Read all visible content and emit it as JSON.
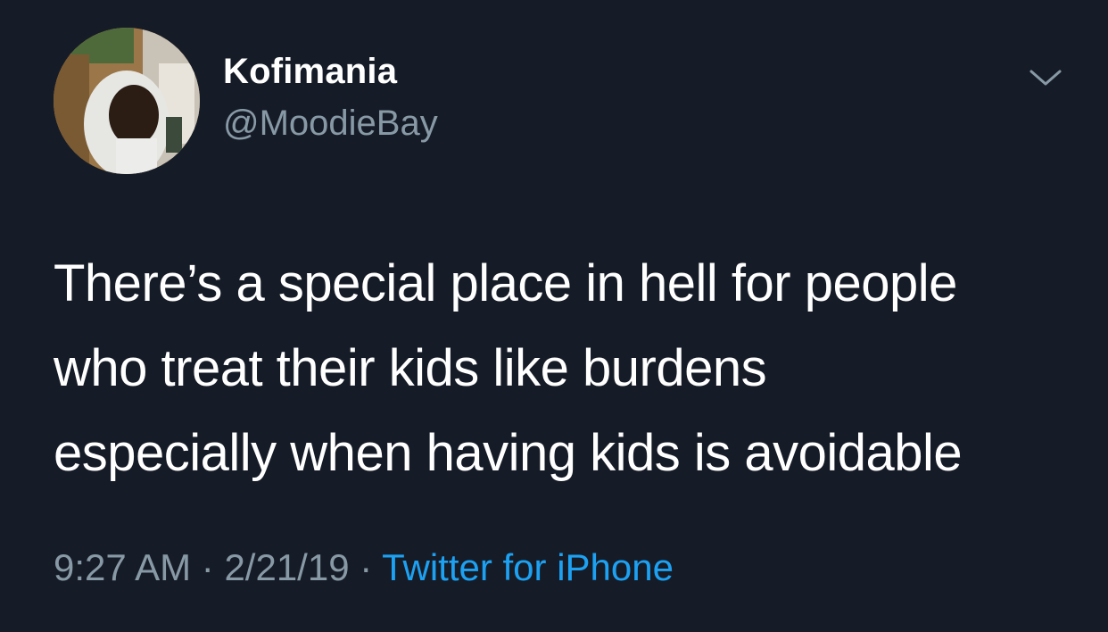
{
  "user": {
    "display_name": "Kofimania",
    "handle": "@MoodieBay"
  },
  "tweet": {
    "lines": [
      "There’s a special place in hell for people",
      "who treat their kids like burdens",
      "especially when having kids is avoidable"
    ]
  },
  "meta": {
    "time": "9:27 AM",
    "sep1": " · ",
    "date": "2/21/19",
    "sep2": " · ",
    "source": "Twitter for iPhone"
  },
  "icons": {
    "menu": "chevron-down-icon",
    "avatar": "profile-photo"
  },
  "colors": {
    "background": "#161c27",
    "secondary_text": "#8899a6",
    "link": "#1da1f2"
  }
}
